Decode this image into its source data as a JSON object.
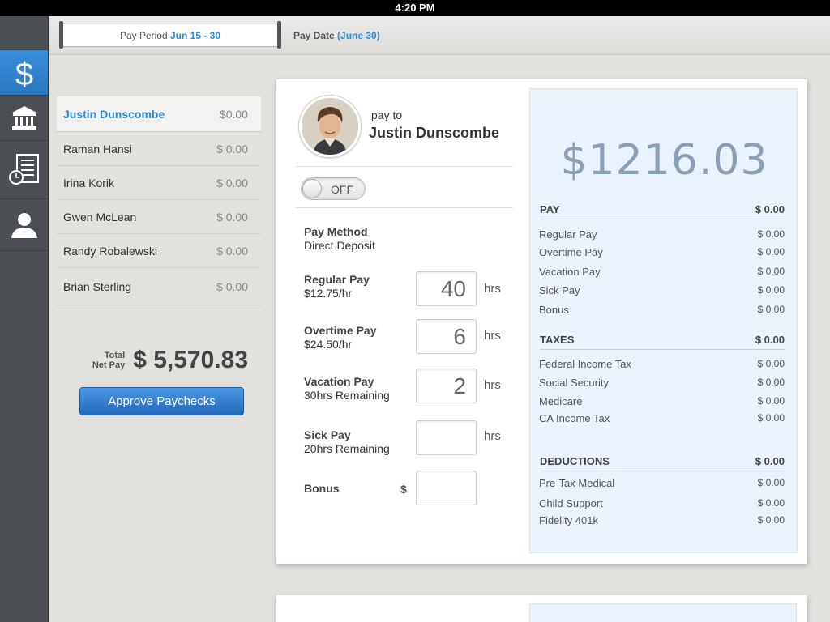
{
  "status_bar": {
    "time": "4:20 PM"
  },
  "header": {
    "pay_period_label": "Pay Period",
    "pay_period_value": "Jun 15 - 30",
    "pay_date_label": "Pay Date",
    "pay_date_value": "(June 30)"
  },
  "rail": {
    "items": [
      "dollar-icon",
      "bank-icon",
      "timesheet-icon",
      "person-icon"
    ],
    "active": "dollar-icon",
    "accent_color": "#2d8ad6"
  },
  "employees": [
    {
      "name": "Justin Dunscombe",
      "amount": "$0.00",
      "selected": true
    },
    {
      "name": "Raman Hansi",
      "amount": "$ 0.00"
    },
    {
      "name": "Irina Korik",
      "amount": "$ 0.00"
    },
    {
      "name": "Gwen McLean",
      "amount": "$ 0.00"
    },
    {
      "name": "Randy Robalewski",
      "amount": "$ 0.00"
    },
    {
      "name": "Brian Sterling",
      "amount": "$ 0.00"
    }
  ],
  "totals": {
    "label_line1": "Total",
    "label_line2": "Net Pay",
    "value": "$ 5,570.83",
    "approve_label": "Approve Paychecks"
  },
  "detail": {
    "pay_to_label": "pay to",
    "name": "Justin Dunscombe",
    "toggle_label": "OFF",
    "pay_method_label": "Pay Method",
    "pay_method_value": "Direct Deposit",
    "regular_label": "Regular Pay",
    "regular_rate": "$12.75/hr",
    "regular_hours": "40",
    "overtime_label": "Overtime Pay",
    "overtime_rate": "$24.50/hr",
    "overtime_hours": "6",
    "vacation_label": "Vacation Pay",
    "vacation_sub": "30hrs Remaining",
    "vacation_hours": "2",
    "sick_label": "Sick Pay",
    "sick_sub": "20hrs Remaining",
    "sick_hours": "",
    "bonus_label": "Bonus",
    "bonus_currency": "$",
    "bonus_value": "",
    "hrs_unit": "hrs"
  },
  "summary": {
    "net_amount": "$1216.03",
    "pay": {
      "title": "PAY",
      "total": "$ 0.00",
      "items": [
        {
          "label": "Regular Pay",
          "value": "$ 0.00"
        },
        {
          "label": "Overtime Pay",
          "value": "$ 0.00"
        },
        {
          "label": "Vacation Pay",
          "value": "$ 0.00"
        },
        {
          "label": "Sick Pay",
          "value": "$ 0.00"
        },
        {
          "label": "Bonus",
          "value": "$ 0.00"
        }
      ]
    },
    "taxes": {
      "title": "TAXES",
      "total": "$ 0.00",
      "items": [
        {
          "label": "Federal Income Tax",
          "value": "$ 0.00"
        },
        {
          "label": "Social Security",
          "value": "$ 0.00"
        },
        {
          "label": "Medicare",
          "value": "$ 0.00"
        },
        {
          "label": "CA Income Tax",
          "value": "$ 0.00"
        }
      ]
    },
    "deductions": {
      "title": "DEDUCTIONS",
      "total": "$ 0.00",
      "items": [
        {
          "label": "Pre-Tax Medical",
          "value": "$ 0.00"
        },
        {
          "label": "Child Support",
          "value": "$ 0.00"
        },
        {
          "label": "Fidelity 401k",
          "value": "$ 0.00"
        }
      ]
    }
  }
}
